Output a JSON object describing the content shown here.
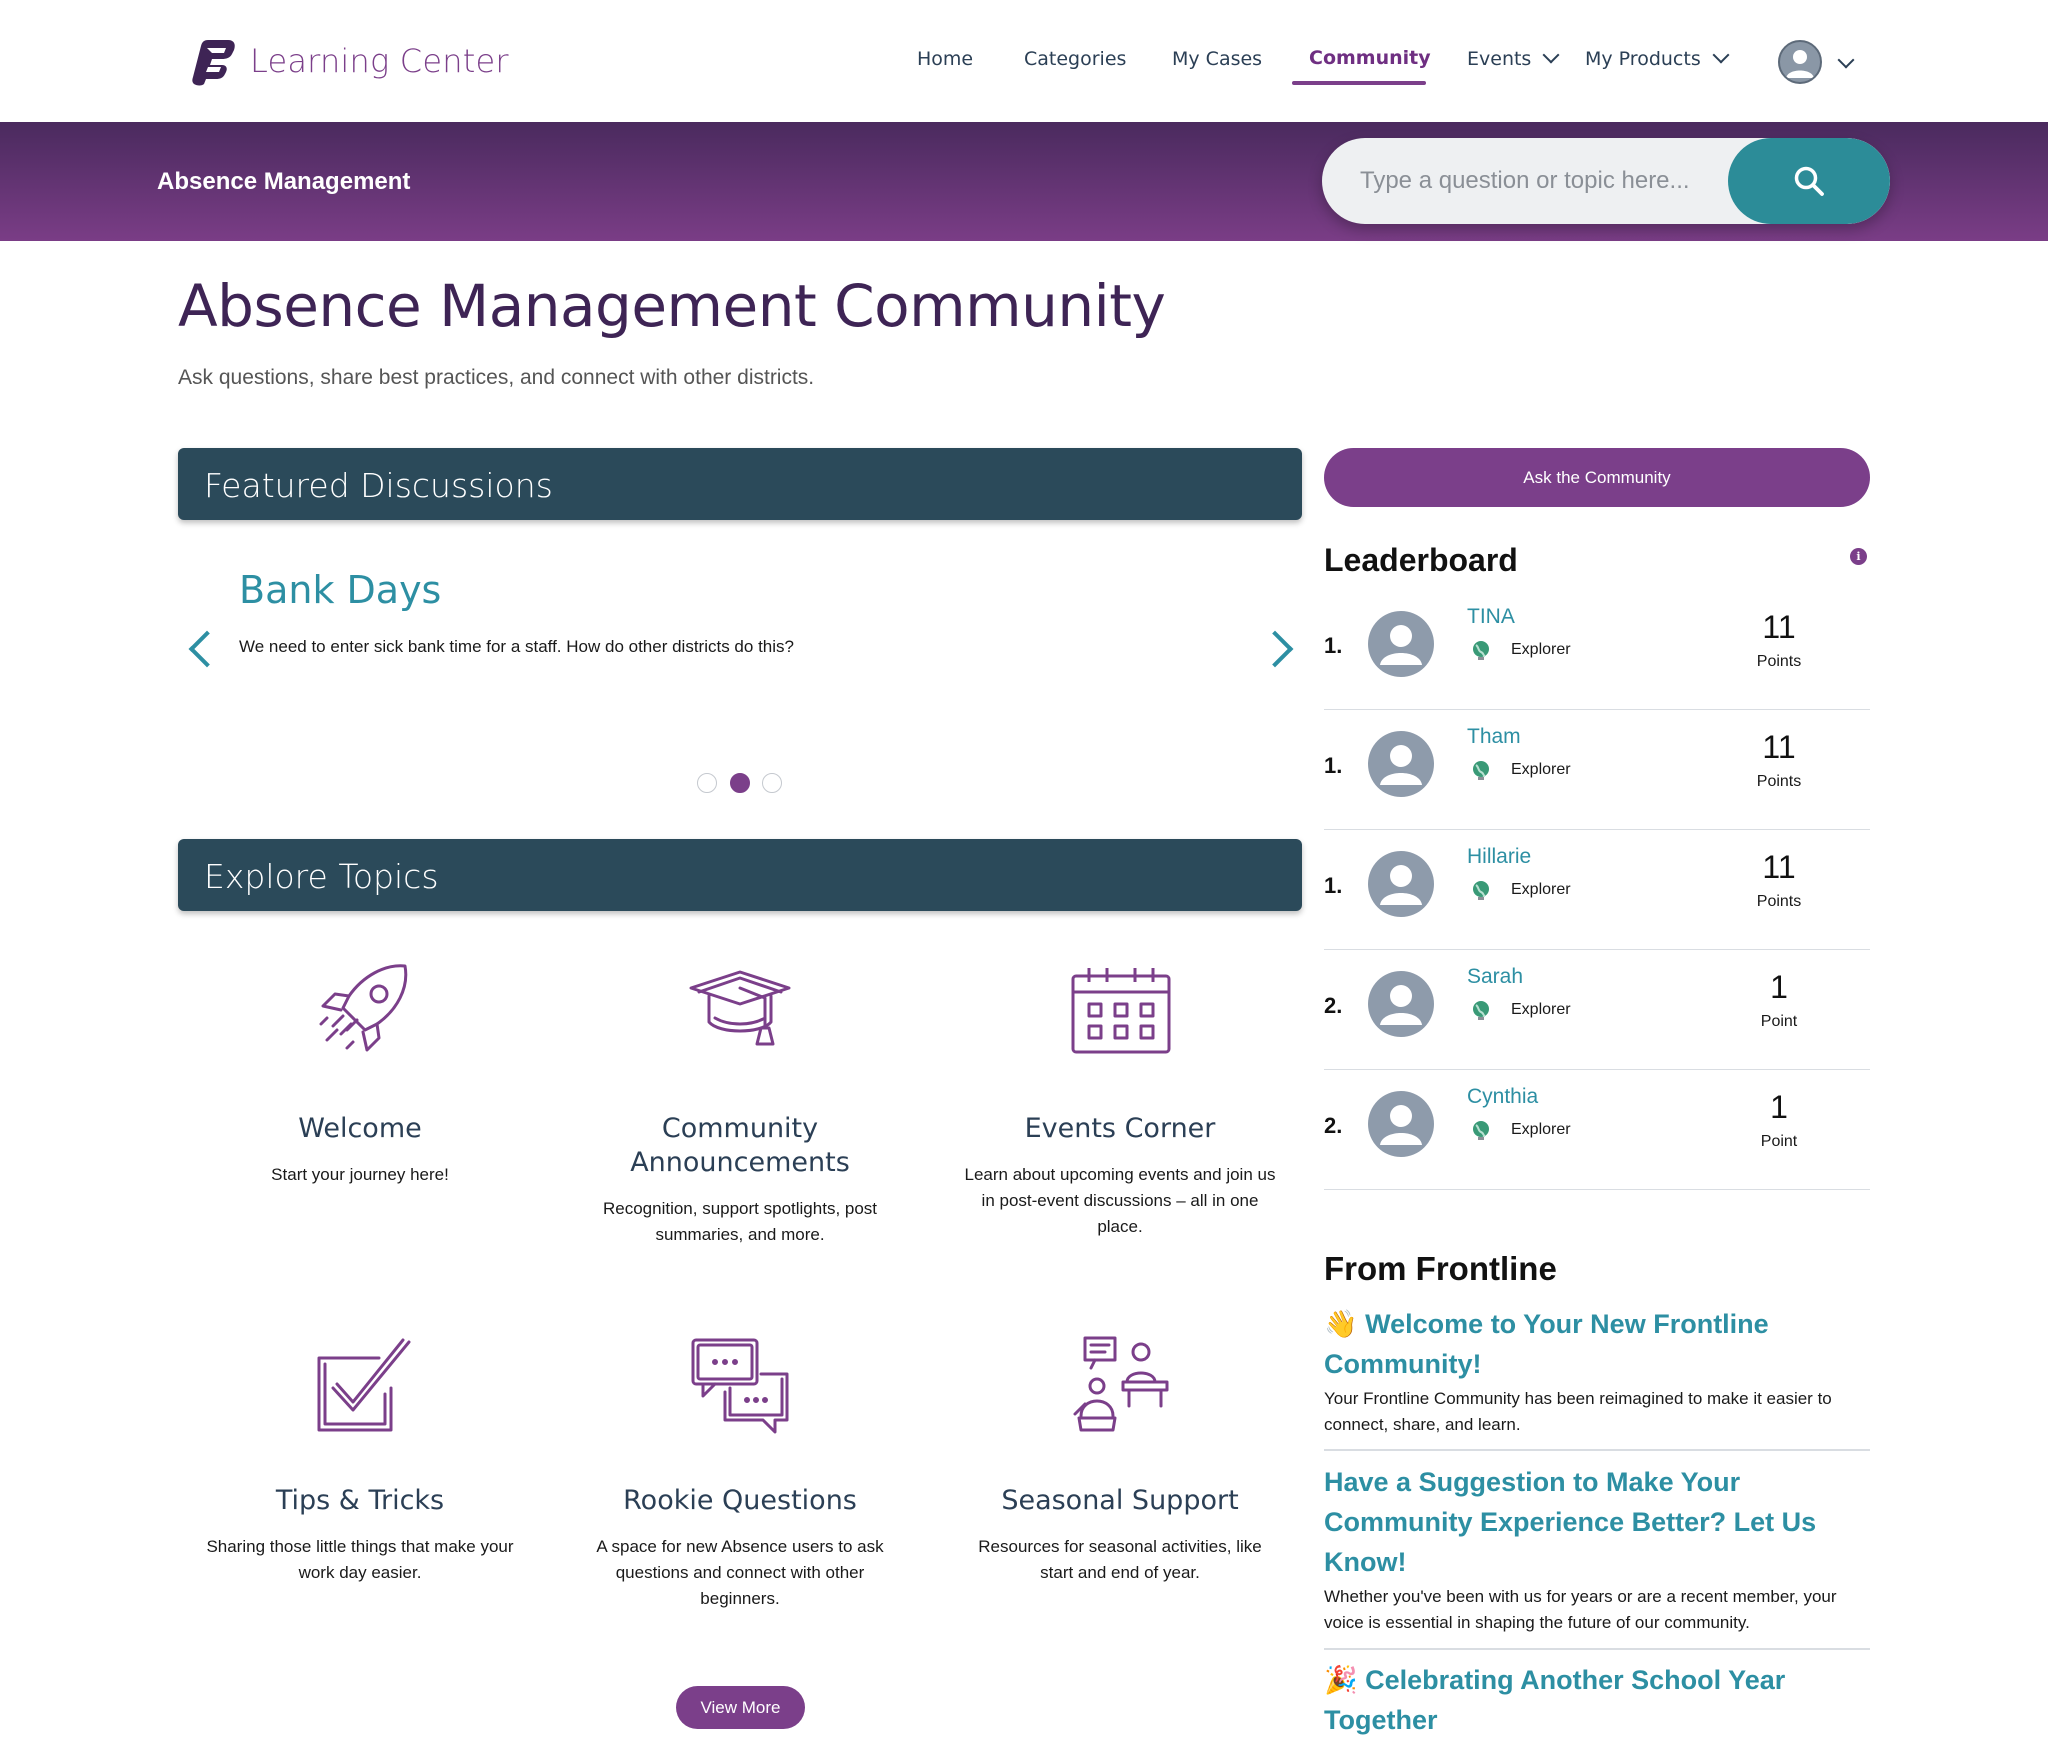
{
  "brand": {
    "name": "Learning Center",
    "color": "#7b3f8a"
  },
  "nav": {
    "items": [
      {
        "label": "Home"
      },
      {
        "label": "Categories"
      },
      {
        "label": "My Cases"
      },
      {
        "label": "Community",
        "active": true
      },
      {
        "label": "Events",
        "has_dropdown": true
      },
      {
        "label": "My Products",
        "has_dropdown": true
      }
    ],
    "user_menu_icon": "user-avatar-icon"
  },
  "banner": {
    "title": "Absence Management",
    "search_placeholder": "Type a question or topic here...",
    "search_icon": "search-icon",
    "search_button_color": "#2c8c98"
  },
  "page": {
    "title": "Absence Management Community",
    "subtitle": "Ask questions, share best practices, and connect with other districts."
  },
  "featured": {
    "heading": "Featured Discussions",
    "current": {
      "title": "Bank Days",
      "text": "We need to enter sick bank time for a staff. How do other districts do this?"
    },
    "slide_index": 2,
    "slide_count": 3
  },
  "topics": {
    "heading": "Explore Topics",
    "items": [
      {
        "title": "Welcome",
        "desc": "Start your journey here!",
        "icon": "rocket-icon"
      },
      {
        "title": "Community Announcements",
        "desc": "Recognition, support spotlights, post summaries, and more.",
        "icon": "graduation-cap-icon"
      },
      {
        "title": "Events Corner",
        "desc": "Learn about upcoming events and join us in post-event discussions – all in one place.",
        "icon": "calendar-icon"
      },
      {
        "title": "Tips & Tricks",
        "desc": "Sharing those little things that make your work day easier.",
        "icon": "checkbox-icon"
      },
      {
        "title": "Rookie Questions",
        "desc": "A space for new Absence users to ask questions and connect with other beginners.",
        "icon": "chat-bubbles-icon"
      },
      {
        "title": "Seasonal Support",
        "desc": "Resources for seasonal activities, like start and end of year.",
        "icon": "classroom-icon"
      }
    ],
    "view_more_label": "View More"
  },
  "sidebar": {
    "ask_button": "Ask the Community",
    "leaderboard": {
      "title": "Leaderboard",
      "info_icon": "info-icon",
      "rows": [
        {
          "rank": "1.",
          "name": "TINA",
          "level": "Explorer",
          "points": "11",
          "points_label": "Points"
        },
        {
          "rank": "1.",
          "name": "Tham",
          "level": "Explorer",
          "points": "11",
          "points_label": "Points"
        },
        {
          "rank": "1.",
          "name": "Hillarie",
          "level": "Explorer",
          "points": "11",
          "points_label": "Points"
        },
        {
          "rank": "2.",
          "name": "Sarah",
          "level": "Explorer",
          "points": "1",
          "points_label": "Point"
        },
        {
          "rank": "2.",
          "name": "Cynthia",
          "level": "Explorer",
          "points": "1",
          "points_label": "Point"
        }
      ]
    },
    "from_frontline": {
      "title": "From Frontline",
      "items": [
        {
          "emoji": "👋",
          "title": "Welcome to Your New Frontline Community!",
          "body": "Your Frontline Community has been reimagined to make it easier to connect, share, and learn."
        },
        {
          "emoji": "",
          "title": "Have a Suggestion to Make Your Community Experience Better? Let Us Know!",
          "body": "Whether you've been with us for years or are a recent member, your voice is essential in shaping the future of our community."
        },
        {
          "emoji": "🎉",
          "title": "Celebrating Another School Year Together",
          "body": ""
        }
      ]
    }
  },
  "colors": {
    "accent": "#7b3f8a",
    "teal": "#2d8fa3",
    "section_bar": "#2b4a5a"
  }
}
